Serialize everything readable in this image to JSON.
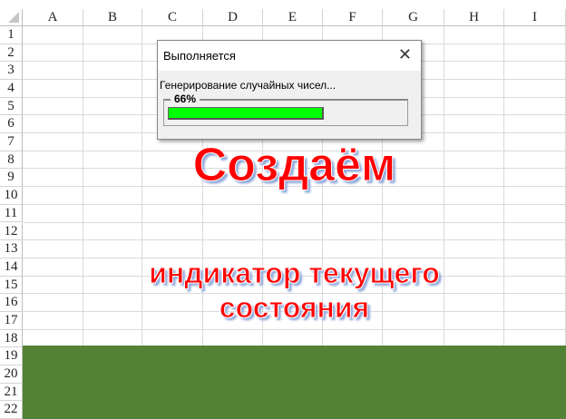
{
  "sheet": {
    "columns": [
      "A",
      "B",
      "C",
      "D",
      "E",
      "F",
      "G",
      "H",
      "I"
    ],
    "rows": [
      "1",
      "2",
      "3",
      "4",
      "5",
      "6",
      "7",
      "8",
      "9",
      "10",
      "11",
      "12",
      "13",
      "14",
      "15",
      "16",
      "17",
      "18",
      "19",
      "20",
      "21",
      "22"
    ]
  },
  "dialog": {
    "title": "Выполняется",
    "message": "Генерирование случайных чисел...",
    "progress_label": "66%",
    "progress": 0.66,
    "close_icon": "close-icon"
  },
  "heading": {
    "line1": "Создаём",
    "line2": "индикатор текущего",
    "line3": "состояния"
  },
  "colors": {
    "band": "#548235",
    "progress_fill": "#00ff00",
    "text": "#ff0000"
  }
}
